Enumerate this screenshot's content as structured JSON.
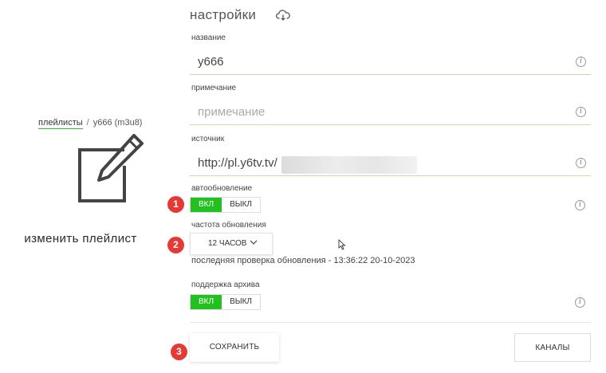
{
  "left": {
    "breadcrumb_link": "плейлисты",
    "breadcrumb_sep": "/",
    "breadcrumb_current": "y666 (m3u8)",
    "edit_caption": "изменить плейлист",
    "edit_icon": "edit-pencil-icon"
  },
  "header": {
    "title": "настройки",
    "cloud_icon": "cloud-download-icon"
  },
  "form": {
    "name_label": "название",
    "name_value": "y666",
    "note_label": "примечание",
    "note_placeholder": "примечание",
    "source_label": "источник",
    "source_value": "http://pl.y6tv.tv/",
    "autoupdate_label": "автообновление",
    "autoupdate_on": "ВКЛ",
    "autoupdate_off": "ВЫКЛ",
    "autoupdate_state": "on",
    "frequency_label": "частота обновления",
    "frequency_value": "12 ЧАСОВ",
    "last_check": "последняя проверка обновления - 13:36:22 20-10-2023",
    "archive_label": "поддержка архива",
    "archive_on": "ВКЛ",
    "archive_off": "ВЫКЛ",
    "archive_state": "on",
    "info_glyph": "i"
  },
  "buttons": {
    "save": "СОХРАНИТЬ",
    "channels": "КАНАЛЫ"
  },
  "badges": [
    "1",
    "2",
    "3"
  ],
  "colors": {
    "accent": "#22c11f",
    "badge": "#e53935",
    "underline": "#b9e6a8"
  }
}
